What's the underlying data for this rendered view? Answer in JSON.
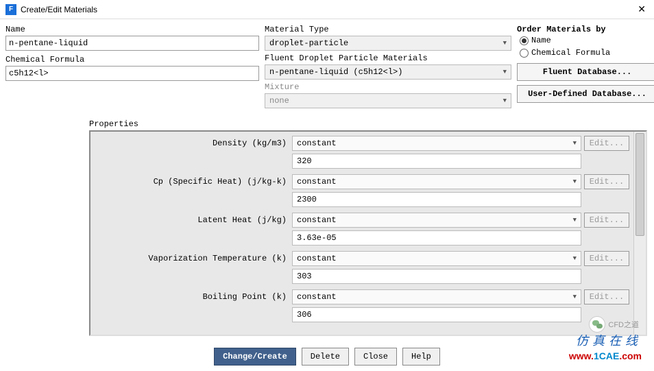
{
  "window": {
    "title": "Create/Edit Materials"
  },
  "left": {
    "nameLabel": "Name",
    "nameValue": "n-pentane-liquid",
    "formulaLabel": "Chemical Formula",
    "formulaValue": "c5h12<l>"
  },
  "mid": {
    "typeLabel": "Material Type",
    "typeValue": "droplet-particle",
    "fdpmLabel": "Fluent Droplet Particle Materials",
    "fdpmValue": "n-pentane-liquid (c5h12<l>)",
    "mixLabel": "Mixture",
    "mixValue": "none"
  },
  "order": {
    "title": "Order Materials by",
    "opt1": "Name",
    "opt2": "Chemical Formula"
  },
  "dbButtons": {
    "fluent": "Fluent Database...",
    "user": "User-Defined Database..."
  },
  "props": {
    "title": "Properties",
    "editLabel": "Edit...",
    "constantLabel": "constant",
    "items": [
      {
        "label": "Density (kg/m3)",
        "value": "320"
      },
      {
        "label": "Cp (Specific Heat) (j/kg-k)",
        "value": "2300"
      },
      {
        "label": "Latent Heat (j/kg)",
        "value": "3.63e-05"
      },
      {
        "label": "Vaporization Temperature (k)",
        "value": "303"
      },
      {
        "label": "Boiling Point (k)",
        "value": "306"
      }
    ]
  },
  "buttons": {
    "change": "Change/Create",
    "delete": "Delete",
    "close": "Close",
    "help": "Help"
  },
  "watermark": {
    "wechat": "CFD之道",
    "brand": "仿真在线",
    "url": "www.1CAE.com"
  }
}
